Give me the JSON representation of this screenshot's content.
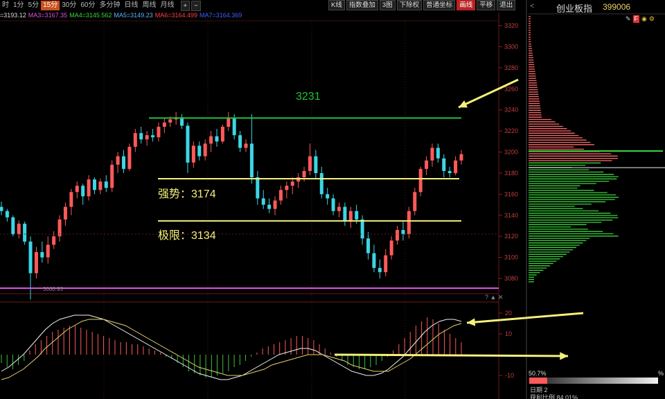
{
  "toolbar": {
    "timeframes": [
      "时",
      "1分",
      "5分",
      "15分",
      "30分",
      "60分",
      "多分钟",
      "日线",
      "周线",
      "月线"
    ],
    "active_timeframe": "15分",
    "zoom_in": "+",
    "zoom_out": "−",
    "buttons": [
      "K线",
      "指数叠加",
      "3图",
      "下除权",
      "普通坐标",
      "画线",
      "平移",
      "退出"
    ],
    "active_button": "画线"
  },
  "ma_line": {
    "close": "=3193.12",
    "ma3": "MA3=3167.35",
    "ma4": "MA4=3145.562",
    "ma5": "MA5=3149.23",
    "ma6": "MA6=3164.499",
    "ma7": "MA7=3164.369"
  },
  "side_panel": {
    "title": "创业板指",
    "code": "399006",
    "pct_left": "50.7%",
    "pct_right": "%",
    "cost_label": "日期 2",
    "profit_ratio": "获利比例 84.01%"
  },
  "annotations": {
    "resistance": "3231",
    "strong": "强势：3174",
    "limit": "极限：3134",
    "low_mark": "3060.95"
  },
  "price_axis": [
    "3320",
    "3300",
    "3280",
    "3260",
    "3240",
    "3220",
    "3200",
    "3180",
    "3160",
    "3140",
    "3120",
    "3100",
    "3080"
  ],
  "macd_axis": [
    "20",
    "10",
    "-10"
  ],
  "colors": {
    "up": "#ff5a5a",
    "down": "#3cd6e6",
    "green_line": "#22c23a",
    "yellow_line": "#f5f07a",
    "magenta_line": "#e050e0",
    "macd_pos": "#ff5a5a",
    "macd_neg": "#3cc23c"
  },
  "chart_data": {
    "type": "candlestick",
    "title": "",
    "ylim": [
      3060,
      3330
    ],
    "candles": [
      [
        3148,
        3153,
        3140,
        3144
      ],
      [
        3144,
        3146,
        3134,
        3138
      ],
      [
        3138,
        3140,
        3120,
        3122
      ],
      [
        3122,
        3135,
        3118,
        3132
      ],
      [
        3132,
        3134,
        3112,
        3115
      ],
      [
        3115,
        3120,
        3060,
        3085
      ],
      [
        3085,
        3110,
        3080,
        3105
      ],
      [
        3105,
        3115,
        3095,
        3100
      ],
      [
        3100,
        3120,
        3094,
        3112
      ],
      [
        3112,
        3125,
        3108,
        3120
      ],
      [
        3120,
        3140,
        3115,
        3136
      ],
      [
        3136,
        3152,
        3130,
        3148
      ],
      [
        3148,
        3165,
        3140,
        3162
      ],
      [
        3162,
        3172,
        3156,
        3168
      ],
      [
        3168,
        3170,
        3150,
        3158
      ],
      [
        3158,
        3178,
        3154,
        3174
      ],
      [
        3174,
        3176,
        3160,
        3164
      ],
      [
        3164,
        3175,
        3160,
        3172
      ],
      [
        3172,
        3178,
        3162,
        3166
      ],
      [
        3166,
        3192,
        3162,
        3188
      ],
      [
        3188,
        3200,
        3180,
        3196
      ],
      [
        3196,
        3202,
        3180,
        3184
      ],
      [
        3184,
        3208,
        3182,
        3205
      ],
      [
        3205,
        3222,
        3200,
        3218
      ],
      [
        3218,
        3224,
        3208,
        3212
      ],
      [
        3212,
        3220,
        3206,
        3216
      ],
      [
        3216,
        3222,
        3210,
        3214
      ],
      [
        3214,
        3228,
        3210,
        3224
      ],
      [
        3224,
        3232,
        3218,
        3228
      ],
      [
        3228,
        3234,
        3224,
        3231
      ],
      [
        3231,
        3238,
        3226,
        3233
      ],
      [
        3233,
        3236,
        3222,
        3225
      ],
      [
        3225,
        3228,
        3180,
        3190
      ],
      [
        3190,
        3210,
        3185,
        3206
      ],
      [
        3206,
        3210,
        3192,
        3196
      ],
      [
        3196,
        3212,
        3192,
        3208
      ],
      [
        3208,
        3220,
        3200,
        3215
      ],
      [
        3215,
        3222,
        3205,
        3210
      ],
      [
        3210,
        3226,
        3208,
        3224
      ],
      [
        3224,
        3238,
        3220,
        3232
      ],
      [
        3232,
        3236,
        3212,
        3216
      ],
      [
        3216,
        3220,
        3200,
        3204
      ],
      [
        3204,
        3212,
        3200,
        3208
      ],
      [
        3208,
        3236,
        3170,
        3176
      ],
      [
        3176,
        3182,
        3150,
        3156
      ],
      [
        3156,
        3164,
        3146,
        3150
      ],
      [
        3150,
        3156,
        3142,
        3146
      ],
      [
        3146,
        3158,
        3140,
        3154
      ],
      [
        3154,
        3168,
        3150,
        3164
      ],
      [
        3164,
        3172,
        3156,
        3168
      ],
      [
        3168,
        3176,
        3160,
        3172
      ],
      [
        3172,
        3180,
        3166,
        3176
      ],
      [
        3176,
        3186,
        3172,
        3182
      ],
      [
        3182,
        3208,
        3178,
        3196
      ],
      [
        3196,
        3202,
        3175,
        3180
      ],
      [
        3180,
        3186,
        3156,
        3160
      ],
      [
        3160,
        3166,
        3150,
        3156
      ],
      [
        3156,
        3160,
        3140,
        3144
      ],
      [
        3144,
        3152,
        3138,
        3148
      ],
      [
        3148,
        3152,
        3130,
        3134
      ],
      [
        3134,
        3148,
        3128,
        3144
      ],
      [
        3144,
        3150,
        3132,
        3136
      ],
      [
        3136,
        3140,
        3112,
        3118
      ],
      [
        3118,
        3124,
        3098,
        3104
      ],
      [
        3104,
        3112,
        3086,
        3090
      ],
      [
        3090,
        3098,
        3080,
        3086
      ],
      [
        3086,
        3108,
        3082,
        3102
      ],
      [
        3102,
        3120,
        3098,
        3116
      ],
      [
        3116,
        3130,
        3112,
        3126
      ],
      [
        3126,
        3134,
        3116,
        3122
      ],
      [
        3122,
        3148,
        3118,
        3144
      ],
      [
        3144,
        3166,
        3140,
        3162
      ],
      [
        3162,
        3186,
        3158,
        3184
      ],
      [
        3184,
        3196,
        3178,
        3192
      ],
      [
        3192,
        3208,
        3186,
        3204
      ],
      [
        3204,
        3208,
        3190,
        3194
      ],
      [
        3194,
        3198,
        3176,
        3182
      ],
      [
        3182,
        3186,
        3176,
        3180
      ],
      [
        3180,
        3196,
        3178,
        3192
      ],
      [
        3192,
        3202,
        3188,
        3198
      ]
    ],
    "levels": {
      "resistance": 3231,
      "strong": 3174,
      "limit": 3134,
      "low": 3060.95
    },
    "macd_hist": [
      -4,
      -6,
      -7,
      -5,
      -3,
      2,
      5,
      7,
      9,
      11,
      12,
      13,
      14,
      14,
      13,
      12,
      11,
      10,
      9,
      8,
      7,
      6,
      6,
      5,
      5,
      4,
      3,
      2,
      1,
      -1,
      -2,
      -4,
      -6,
      -8,
      -9,
      -10,
      -11,
      -11,
      -10,
      -9,
      -8,
      -6,
      -5,
      -3,
      -1,
      1,
      3,
      4,
      5,
      6,
      7,
      8,
      9,
      9,
      8,
      7,
      5,
      3,
      1,
      -1,
      -3,
      -5,
      -6,
      -7,
      -7,
      -6,
      -5,
      -3,
      -1,
      2,
      5,
      8,
      11,
      14,
      16,
      18,
      17,
      15,
      12,
      10,
      8,
      6
    ],
    "dif": [
      -8,
      -6,
      -3,
      0,
      4,
      8,
      12,
      15,
      17,
      18,
      19,
      19,
      19,
      18,
      17,
      15,
      13,
      11,
      9,
      7,
      5,
      3,
      1,
      -1,
      -3,
      -5,
      -7,
      -9,
      -10,
      -11,
      -12,
      -12,
      -11,
      -10,
      -8,
      -6,
      -4,
      -2,
      0,
      1,
      2,
      3,
      3,
      2,
      0,
      -2,
      -4,
      -6,
      -8,
      -9,
      -10,
      -10,
      -9,
      -7,
      -4,
      -1,
      3,
      7,
      11,
      14,
      16,
      17,
      17,
      16
    ],
    "dea": [
      -12,
      -11,
      -9,
      -7,
      -4,
      -1,
      3,
      6,
      9,
      12,
      14,
      16,
      17,
      17,
      17,
      16,
      15,
      14,
      12,
      10,
      8,
      6,
      4,
      2,
      0,
      -2,
      -4,
      -6,
      -7,
      -8,
      -9,
      -10,
      -10,
      -10,
      -9,
      -8,
      -7,
      -5,
      -4,
      -3,
      -2,
      -1,
      0,
      0,
      0,
      -1,
      -2,
      -3,
      -5,
      -6,
      -7,
      -8,
      -8,
      -8,
      -6,
      -4,
      -2,
      1,
      4,
      7,
      10,
      12,
      14,
      15
    ]
  }
}
